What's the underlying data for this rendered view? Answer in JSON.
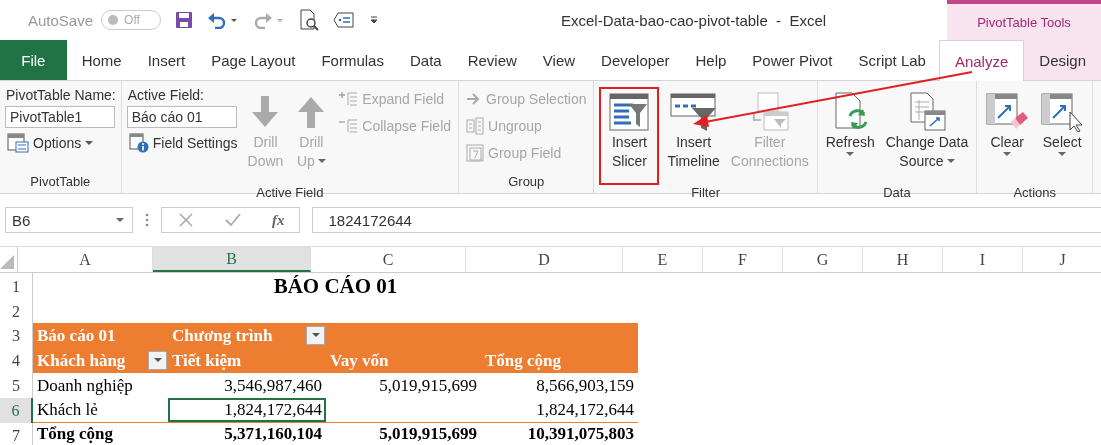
{
  "title_bar": {
    "autosave_label": "AutoSave",
    "autosave": {
      "on": false,
      "label": "Off"
    },
    "title": "Excel-Data-bao-cao-pivot-table  -  Excel",
    "context_label": "PivotTable Tools"
  },
  "tabs": [
    {
      "label": "File",
      "kind": "file",
      "selected": false
    },
    {
      "label": "Home",
      "kind": "normal",
      "selected": false
    },
    {
      "label": "Insert",
      "kind": "normal",
      "selected": false
    },
    {
      "label": "Page Layout",
      "kind": "normal",
      "selected": false
    },
    {
      "label": "Formulas",
      "kind": "normal",
      "selected": false
    },
    {
      "label": "Data",
      "kind": "normal",
      "selected": false
    },
    {
      "label": "Review",
      "kind": "normal",
      "selected": false
    },
    {
      "label": "View",
      "kind": "normal",
      "selected": false
    },
    {
      "label": "Developer",
      "kind": "normal",
      "selected": false
    },
    {
      "label": "Help",
      "kind": "normal",
      "selected": false
    },
    {
      "label": "Power Pivot",
      "kind": "normal",
      "selected": false
    },
    {
      "label": "Script Lab",
      "kind": "normal",
      "selected": false
    },
    {
      "label": "Analyze",
      "kind": "context",
      "selected": true
    },
    {
      "label": "Design",
      "kind": "context",
      "selected": false
    }
  ],
  "ribbon": {
    "groups": [
      {
        "label": "PivotTable",
        "columns": [
          {
            "kind": "stack",
            "items": [
              {
                "kind": "caption",
                "label": "PivotTable Name:"
              },
              {
                "kind": "input",
                "value": "PivotTable1"
              },
              {
                "kind": "small",
                "label": "Options",
                "disabled": false,
                "dropdown": true
              }
            ]
          }
        ]
      },
      {
        "label": "Active Field",
        "columns": [
          {
            "kind": "stack",
            "items": [
              {
                "kind": "caption",
                "label": "Active Field:"
              },
              {
                "kind": "input",
                "value": "Báo cáo 01"
              },
              {
                "kind": "small",
                "label": "Field Settings",
                "disabled": false,
                "dropdown": false
              }
            ]
          },
          {
            "kind": "large",
            "items": [
              {
                "kind": "large",
                "lines": [
                  "Drill",
                  "Down"
                ],
                "disabled": true,
                "dropdown": false,
                "highlighted": false
              }
            ]
          },
          {
            "kind": "large",
            "items": [
              {
                "kind": "large",
                "lines": [
                  "Drill",
                  "Up"
                ],
                "disabled": true,
                "dropdown": true,
                "highlighted": false
              }
            ]
          },
          {
            "kind": "stack",
            "items": [
              {
                "kind": "small",
                "label": "Expand Field",
                "disabled": true,
                "dropdown": false
              },
              {
                "kind": "small",
                "label": "Collapse Field",
                "disabled": true,
                "dropdown": false
              }
            ]
          }
        ]
      },
      {
        "label": "Group",
        "columns": [
          {
            "kind": "stack",
            "items": [
              {
                "kind": "small",
                "label": "Group Selection",
                "disabled": true,
                "dropdown": false
              },
              {
                "kind": "small",
                "label": "Ungroup",
                "disabled": true,
                "dropdown": false
              },
              {
                "kind": "small",
                "label": "Group Field",
                "disabled": true,
                "dropdown": false
              }
            ]
          }
        ]
      },
      {
        "label": "Filter",
        "columns": [
          {
            "kind": "large",
            "items": [
              {
                "kind": "large",
                "lines": [
                  "Insert",
                  "Slicer"
                ],
                "disabled": false,
                "dropdown": false,
                "highlighted": true
              }
            ]
          },
          {
            "kind": "large",
            "items": [
              {
                "kind": "large",
                "lines": [
                  "Insert",
                  "Timeline"
                ],
                "disabled": false,
                "dropdown": false,
                "highlighted": false
              }
            ]
          },
          {
            "kind": "large",
            "items": [
              {
                "kind": "large",
                "lines": [
                  "Filter",
                  "Connections"
                ],
                "disabled": true,
                "dropdown": false,
                "highlighted": false
              }
            ]
          }
        ]
      },
      {
        "label": "Data",
        "columns": [
          {
            "kind": "large",
            "items": [
              {
                "kind": "large",
                "lines": [
                  "Refresh"
                ],
                "disabled": false,
                "dropdown": true,
                "highlighted": false
              }
            ]
          },
          {
            "kind": "large",
            "items": [
              {
                "kind": "large",
                "lines": [
                  "Change Data",
                  "Source"
                ],
                "disabled": false,
                "dropdown": true,
                "highlighted": false
              }
            ]
          }
        ]
      },
      {
        "label": "Actions",
        "columns": [
          {
            "kind": "large",
            "items": [
              {
                "kind": "large",
                "lines": [
                  "Clear"
                ],
                "disabled": false,
                "dropdown": true,
                "highlighted": false
              }
            ]
          },
          {
            "kind": "large",
            "items": [
              {
                "kind": "large",
                "lines": [
                  "Select"
                ],
                "disabled": false,
                "dropdown": true,
                "highlighted": false
              }
            ]
          }
        ]
      }
    ]
  },
  "annotations": [
    {
      "kind": "arrow"
    }
  ],
  "formula_bar": {
    "name_box": "B6",
    "function_label": "fx",
    "formula": "1824172644"
  },
  "sheet": {
    "columns": [
      {
        "label": "A",
        "selected": false
      },
      {
        "label": "B",
        "selected": true
      },
      {
        "label": "C",
        "selected": false
      },
      {
        "label": "D",
        "selected": false
      },
      {
        "label": "E",
        "selected": false
      },
      {
        "label": "F",
        "selected": false
      },
      {
        "label": "G",
        "selected": false
      },
      {
        "label": "H",
        "selected": false
      },
      {
        "label": "I",
        "selected": false
      },
      {
        "label": "J",
        "selected": false
      }
    ],
    "rows": [
      {
        "number": "1",
        "kind": "title",
        "selected": false,
        "cells": [
          {
            "text": "BÁO CÁO 01",
            "selected": false
          }
        ]
      },
      {
        "number": "2",
        "kind": "blank",
        "selected": false
      },
      {
        "number": "3",
        "kind": "header",
        "selected": false,
        "cells": [
          {
            "text": "Báo cáo 01",
            "selected": false,
            "filter": false
          },
          {
            "text": "Chương trình",
            "selected": false,
            "filter": true
          }
        ]
      },
      {
        "number": "4",
        "kind": "header",
        "selected": false,
        "cells": [
          {
            "text": "Khách hàng",
            "selected": false,
            "filter": true
          },
          {
            "text": "Tiết kiệm",
            "selected": false,
            "filter": false
          },
          {
            "text": "Vay vốn",
            "selected": false,
            "filter": false
          },
          {
            "text": "Tổng cộng",
            "selected": false,
            "filter": false
          }
        ]
      },
      {
        "number": "5",
        "kind": "data",
        "selected": false,
        "cells": [
          {
            "text": "Doanh nghiệp",
            "selected": false
          },
          {
            "text": "3,546,987,460",
            "selected": false
          },
          {
            "text": "5,019,915,699",
            "selected": false
          },
          {
            "text": "8,566,903,159",
            "selected": false
          }
        ]
      },
      {
        "number": "6",
        "kind": "data",
        "selected": true,
        "cells": [
          {
            "text": "Khách lẻ",
            "selected": false
          },
          {
            "text": "1,824,172,644",
            "selected": true
          },
          {
            "selected": false
          },
          {
            "text": "1,824,172,644",
            "selected": false
          }
        ]
      },
      {
        "number": "7",
        "kind": "total",
        "selected": false,
        "cells": [
          {
            "text": "Tổng cộng",
            "selected": false
          },
          {
            "text": "5,371,160,104",
            "selected": false
          },
          {
            "text": "5,019,915,699",
            "selected": false
          },
          {
            "text": "10,391,075,803",
            "selected": false
          }
        ]
      }
    ]
  }
}
